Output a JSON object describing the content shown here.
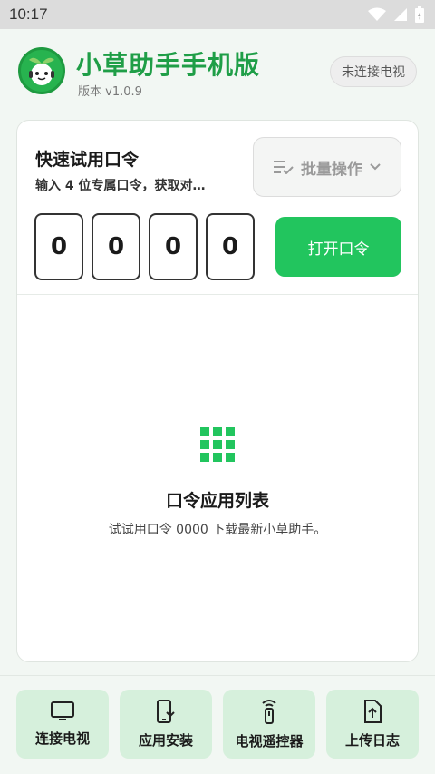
{
  "status_bar": {
    "time": "10:17",
    "icons": [
      "wifi-icon",
      "signal-icon",
      "battery-icon"
    ]
  },
  "header": {
    "title": "小草助手手机版",
    "version": "版本 v1.0.9",
    "tv_status": "未连接电视"
  },
  "quick_code": {
    "title": "快速试用口令",
    "description": "输入 4 位专属口令，获取对…",
    "batch_label": "批量操作",
    "digits": [
      "0",
      "0",
      "0",
      "0"
    ],
    "open_label": "打开口令"
  },
  "code_list": {
    "icon": "grid-icon",
    "title": "口令应用列表",
    "description": "试试用口令 0000 下载最新小草助手。"
  },
  "bottom_nav": [
    {
      "label": "连接电视",
      "icon": "tv-icon"
    },
    {
      "label": "应用安装",
      "icon": "install-icon"
    },
    {
      "label": "电视遥控器",
      "icon": "remote-icon"
    },
    {
      "label": "上传日志",
      "icon": "upload-log-icon"
    }
  ],
  "colors": {
    "accent": "#22c55e",
    "title_green": "#1f9e47",
    "nav_bg": "#d6f0dc",
    "background": "#f2f7f3"
  }
}
